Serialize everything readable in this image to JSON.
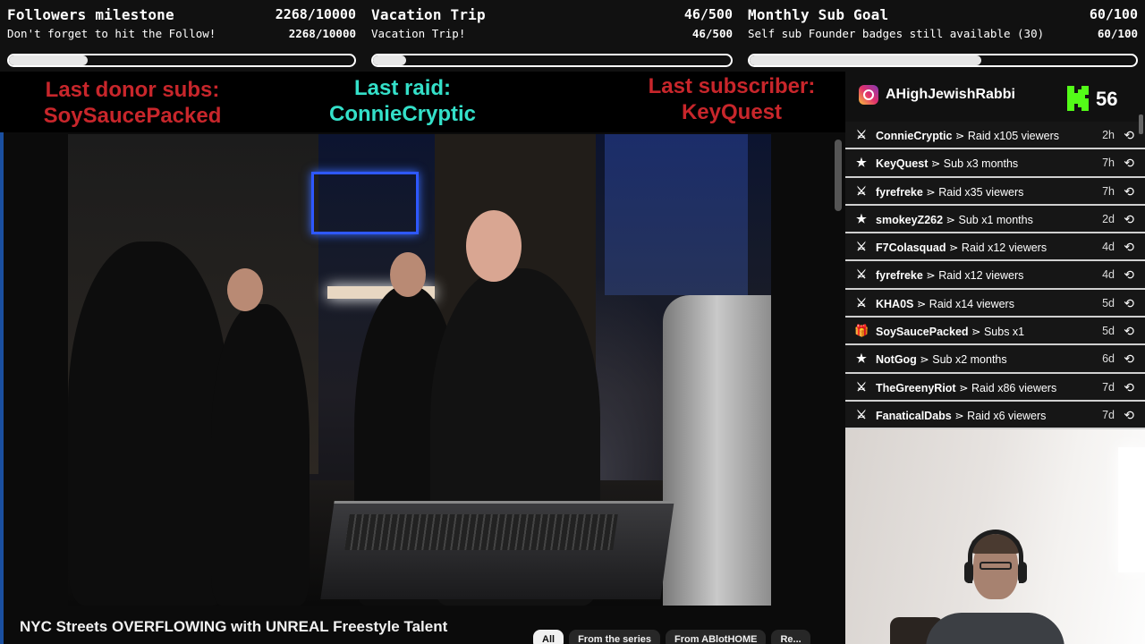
{
  "goals": [
    {
      "title": "Followers milestone",
      "count": "2268/10000",
      "subtitle": "Don't forget to hit the Follow!",
      "count_small": "2268/10000",
      "progress": 0.2268
    },
    {
      "title": "Vacation Trip",
      "count": "46/500",
      "subtitle": "Vacation Trip!",
      "count_small": "46/500",
      "progress": 0.092
    },
    {
      "title": "Monthly Sub Goal",
      "count": "60/100",
      "subtitle": "Self sub Founder badges still available (30)",
      "count_small": "60/100",
      "progress": 0.6
    }
  ],
  "alerts": {
    "donor_label": "Last donor subs:",
    "donor_value": "SoySaucePacked",
    "raid_label": "Last raid:",
    "raid_value": "ConnieCryptic",
    "sub_label": "Last subscriber:",
    "sub_value": "KeyQuest"
  },
  "colors": {
    "alert_red": "#c8262b",
    "alert_cyan": "#34e0c9",
    "kick_green": "#53fc18",
    "instagram_pink": "#e1306c"
  },
  "social": {
    "instagram_icon": "instagram-icon",
    "instagram_handle": "AHighJewishRabbi",
    "kick_icon": "kick-icon",
    "kick_count": "56"
  },
  "feed": [
    {
      "icon": "raid-icon",
      "glyph": "⚔",
      "user": "ConnieCryptic",
      "action": " ⋗ Raid x105 viewers",
      "time": "2h"
    },
    {
      "icon": "star-icon",
      "glyph": "★",
      "user": "KeyQuest",
      "action": " ⋗ Sub x3 months",
      "time": "7h"
    },
    {
      "icon": "raid-icon",
      "glyph": "⚔",
      "user": "fyrefreke",
      "action": " ⋗ Raid x35 viewers",
      "time": "7h"
    },
    {
      "icon": "star-icon",
      "glyph": "★",
      "user": "smokeyZ262",
      "action": " ⋗ Sub x1 months",
      "time": "2d"
    },
    {
      "icon": "raid-icon",
      "glyph": "⚔",
      "user": "F7Colasquad",
      "action": " ⋗ Raid x12 viewers",
      "time": "4d"
    },
    {
      "icon": "raid-icon",
      "glyph": "⚔",
      "user": "fyrefreke",
      "action": " ⋗ Raid x12 viewers",
      "time": "4d"
    },
    {
      "icon": "raid-icon",
      "glyph": "⚔",
      "user": "KHA0S",
      "action": " ⋗ Raid x14 viewers",
      "time": "5d"
    },
    {
      "icon": "gift-icon",
      "glyph": "🎁",
      "user": "SoySaucePacked",
      "action": " ⋗ Subs x1",
      "time": "5d"
    },
    {
      "icon": "star-icon",
      "glyph": "★",
      "user": "NotGog",
      "action": " ⋗ Sub x2 months",
      "time": "6d"
    },
    {
      "icon": "raid-icon",
      "glyph": "⚔",
      "user": "TheGreenyRiot",
      "action": " ⋗ Raid x86 viewers",
      "time": "7d"
    },
    {
      "icon": "raid-icon",
      "glyph": "⚔",
      "user": "FanaticalDabs",
      "action": " ⋗ Raid x6 viewers",
      "time": "7d"
    }
  ],
  "video": {
    "title": "NYC Streets OVERFLOWING with UNREAL Freestyle Talent",
    "chips": [
      "All",
      "From the series",
      "From ABlotHOME",
      "Re..."
    ]
  },
  "replay_glyph": "⟲"
}
